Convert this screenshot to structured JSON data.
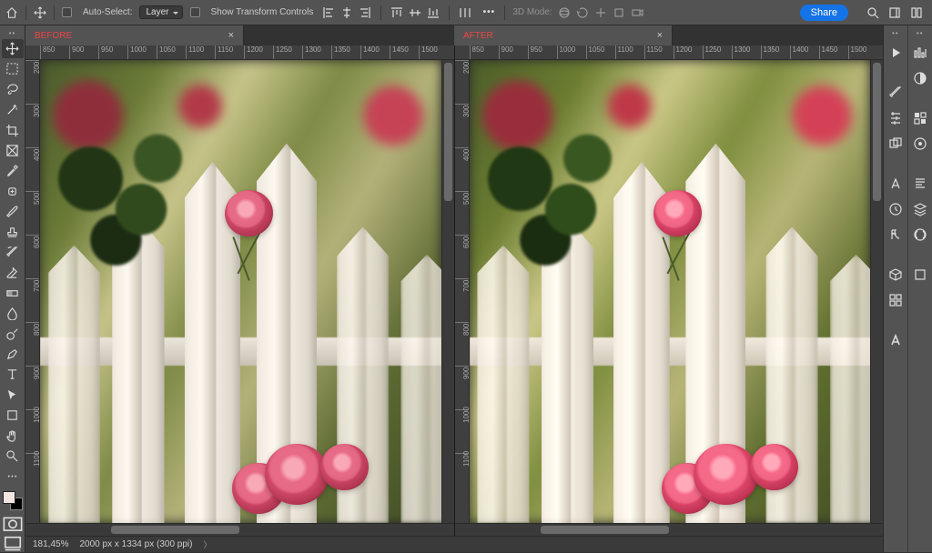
{
  "options_bar": {
    "auto_select_label": "Auto-Select:",
    "layer_dropdown": "Layer",
    "show_transform_label": "Show Transform Controls",
    "d3_label": "3D Mode:",
    "share_label": "Share"
  },
  "tabs": {
    "left": {
      "title": "BEFORE"
    },
    "right": {
      "title": "AFTER"
    }
  },
  "rulers": {
    "h": [
      "850",
      "900",
      "950",
      "1000",
      "1050",
      "1100",
      "1150",
      "1200",
      "1250",
      "1300",
      "1350",
      "1400",
      "1450",
      "1500"
    ],
    "v": [
      "200",
      "300",
      "400",
      "500",
      "600",
      "700",
      "800",
      "900",
      "1000",
      "1100"
    ]
  },
  "status": {
    "zoom": "181,45%",
    "dimensions": "2000 px x 1334 px (300 ppi)"
  },
  "panel_icons": {
    "left_col": [
      "play",
      "brush",
      "ruler",
      "stack",
      "type",
      "clock",
      "fx",
      "cube",
      "grid",
      "font"
    ],
    "right_col": [
      "histogram",
      "contrast",
      "swatches",
      "adjust",
      "paragraph",
      "layers",
      "sync",
      "box"
    ]
  },
  "tools": [
    "move",
    "artboard",
    "lasso",
    "wand",
    "crop",
    "frame",
    "eyedropper",
    "heal",
    "brush",
    "stamp",
    "history-brush",
    "eraser",
    "gradient",
    "blur",
    "dodge",
    "pen",
    "type",
    "path",
    "shape",
    "hand",
    "zoom"
  ]
}
